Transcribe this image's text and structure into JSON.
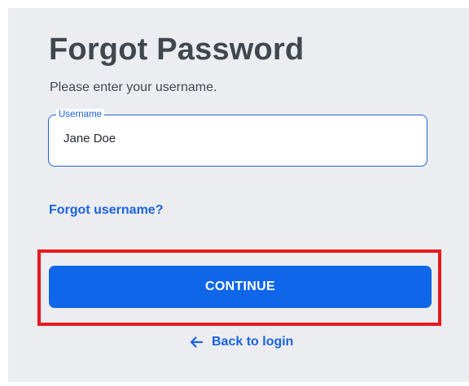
{
  "page": {
    "title": "Forgot Password",
    "subtitle": "Please enter your username."
  },
  "username_field": {
    "label": "Username",
    "value": "Jane Doe"
  },
  "links": {
    "forgot_username": "Forgot username?",
    "back_to_login": "Back to login"
  },
  "actions": {
    "continue_label": "CONTINUE"
  },
  "icons": {
    "back": "arrow-left-icon"
  },
  "colors": {
    "panel_background": "#ecedf0",
    "accent": "#1a63e0",
    "button": "#0f66e9",
    "highlight": "#e8191d",
    "title_text": "#41474f"
  }
}
